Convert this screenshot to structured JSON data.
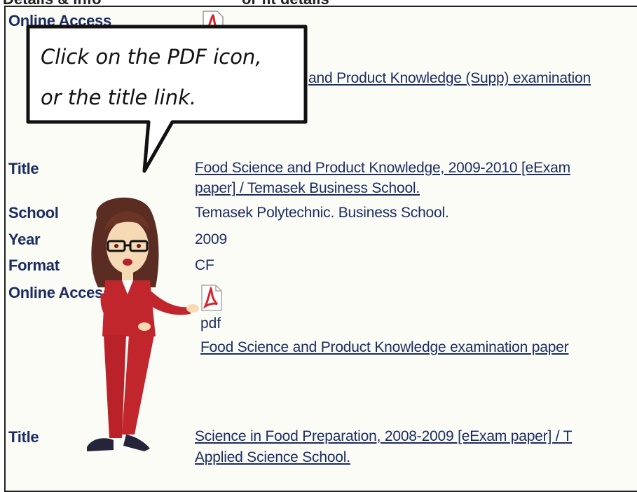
{
  "top_partial": {
    "left": "Details & Info",
    "right": "or fit details"
  },
  "record1": {
    "online_label": "Online Access",
    "link": "and Product Knowledge (Supp) examination"
  },
  "record2": {
    "title_label": "Title",
    "title_line1": "Food Science and Product Knowledge, 2009-2010 [eExam",
    "title_line2": "paper] / Temasek Business School.",
    "school_label": "School",
    "school": "Temasek Polytechnic. Business School.",
    "year_label": "Year",
    "year": "2009",
    "format_label": "Format",
    "format": "CF",
    "online_label": "Online Access",
    "pdf_label": "pdf",
    "link": "Food Science and Product Knowledge examination paper"
  },
  "record3": {
    "title_label": "Title",
    "title_line1": "Science in Food Preparation, 2008-2009 [eExam paper] / T",
    "title_line2": "Applied Science School."
  },
  "callout": {
    "line1": "Click on the PDF icon,",
    "line2": "or the title link."
  },
  "colors": {
    "text": "#1c2c63",
    "background": "#fbfcf6",
    "avatar_suit": "#c0262c",
    "pdf_icon": "#d8232a"
  }
}
